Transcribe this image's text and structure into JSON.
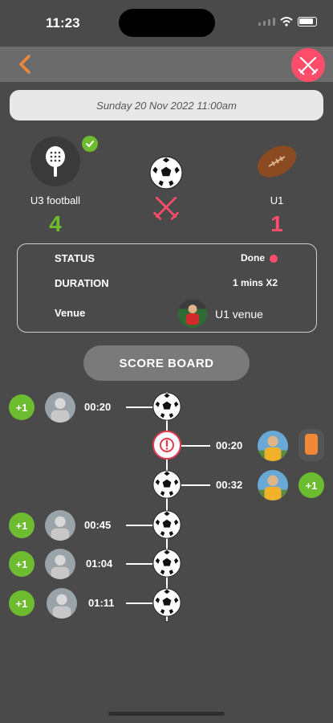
{
  "status_bar": {
    "time": "11:23"
  },
  "nav": {
    "back_icon": "chevron-left-icon",
    "close_icon": "crossed-swords-icon"
  },
  "match": {
    "datetime": "Sunday 20 Nov 2022 11:00am",
    "home": {
      "name": "U3 football",
      "score": "4",
      "icon": "padel-racket-icon"
    },
    "away": {
      "name": "U1",
      "score": "1",
      "icon": "american-football-icon"
    }
  },
  "info": {
    "status_label": "STATUS",
    "status_value": "Done",
    "duration_label": "DURATION",
    "duration_value": "1 mins X2",
    "venue_label": "Venue",
    "venue_value": "U1 venue"
  },
  "scoreboard_label": "SCORE BOARD",
  "events": [
    {
      "side": "home",
      "time": "00:20",
      "badge": "+1",
      "type": "goal"
    },
    {
      "side": "away",
      "time": "00:20",
      "badge": "",
      "type": "card"
    },
    {
      "side": "away",
      "time": "00:32",
      "badge": "+1",
      "type": "goal"
    },
    {
      "side": "home",
      "time": "00:45",
      "badge": "+1",
      "type": "goal"
    },
    {
      "side": "home",
      "time": "01:04",
      "badge": "+1",
      "type": "goal"
    },
    {
      "side": "home",
      "time": "01:11",
      "badge": "+1",
      "type": "goal"
    }
  ],
  "colors": {
    "accent_green": "#6dbb2f",
    "accent_red": "#ff4d6a",
    "accent_orange": "#f0883a"
  }
}
